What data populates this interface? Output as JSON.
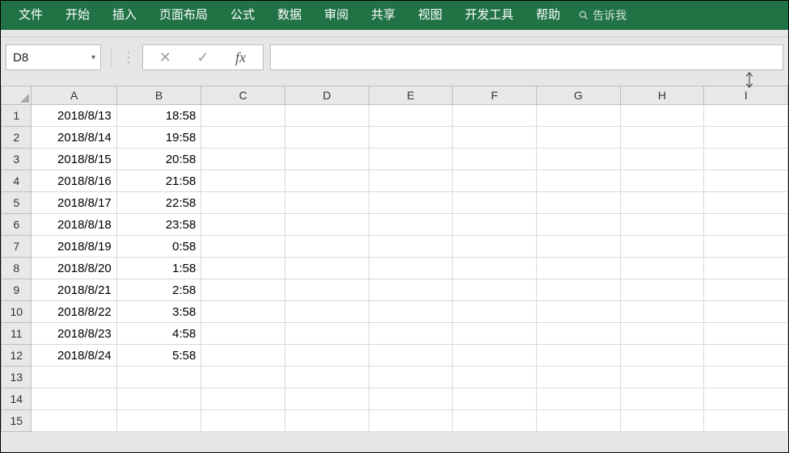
{
  "ribbon": {
    "tabs": [
      "文件",
      "开始",
      "插入",
      "页面布局",
      "公式",
      "数据",
      "审阅",
      "共享",
      "视图",
      "开发工具",
      "帮助"
    ],
    "tell_me": "告诉我"
  },
  "formula_bar": {
    "name_box": "D8",
    "cancel": "✕",
    "enter": "✓",
    "fx": "fx",
    "formula_value": ""
  },
  "sheet": {
    "columns": [
      "A",
      "B",
      "C",
      "D",
      "E",
      "F",
      "G",
      "H",
      "I"
    ],
    "row_count": 15,
    "rows": [
      {
        "n": "1",
        "A": "2018/8/13",
        "B": "18:58"
      },
      {
        "n": "2",
        "A": "2018/8/14",
        "B": "19:58"
      },
      {
        "n": "3",
        "A": "2018/8/15",
        "B": "20:58"
      },
      {
        "n": "4",
        "A": "2018/8/16",
        "B": "21:58"
      },
      {
        "n": "5",
        "A": "2018/8/17",
        "B": "22:58"
      },
      {
        "n": "6",
        "A": "2018/8/18",
        "B": "23:58"
      },
      {
        "n": "7",
        "A": "2018/8/19",
        "B": "0:58"
      },
      {
        "n": "8",
        "A": "2018/8/20",
        "B": "1:58"
      },
      {
        "n": "9",
        "A": "2018/8/21",
        "B": "2:58"
      },
      {
        "n": "10",
        "A": "2018/8/22",
        "B": "3:58"
      },
      {
        "n": "11",
        "A": "2018/8/23",
        "B": "4:58"
      },
      {
        "n": "12",
        "A": "2018/8/24",
        "B": "5:58"
      },
      {
        "n": "13",
        "A": "",
        "B": ""
      },
      {
        "n": "14",
        "A": "",
        "B": ""
      },
      {
        "n": "15",
        "A": "",
        "B": ""
      }
    ]
  }
}
